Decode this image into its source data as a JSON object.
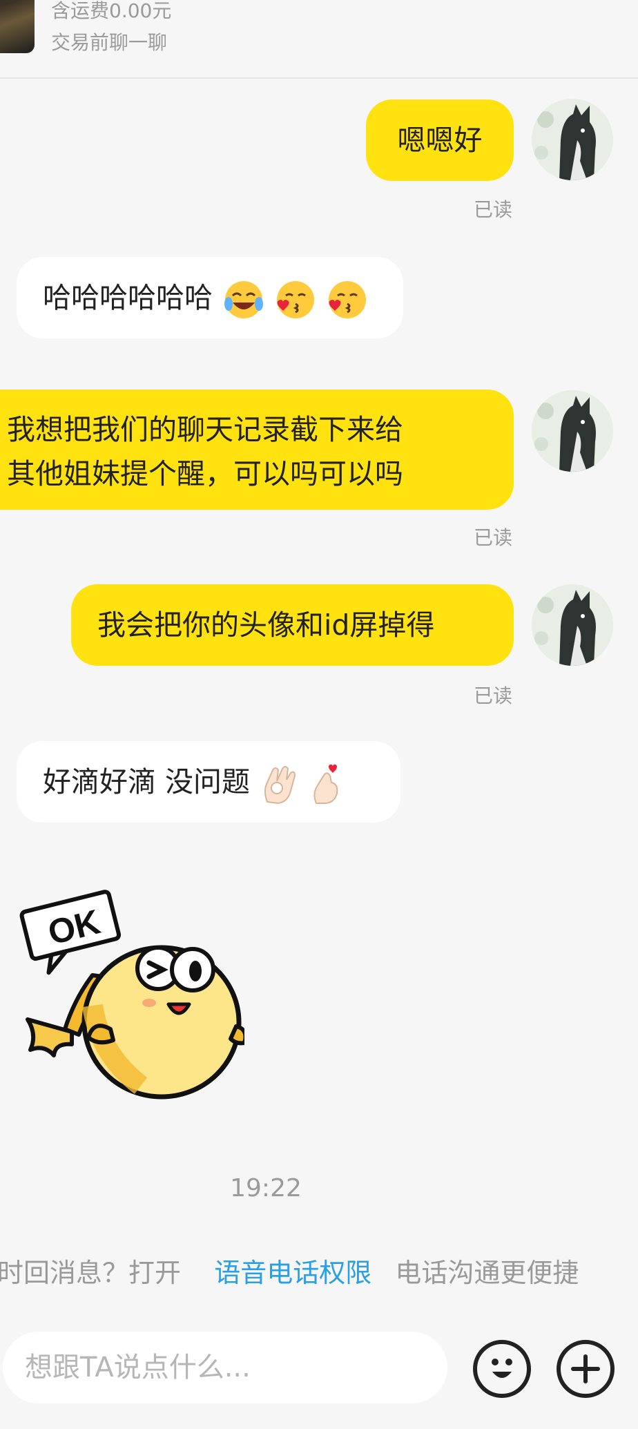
{
  "header": {
    "shipping": "含运费0.00元",
    "chat_prompt": "交易前聊一聊"
  },
  "messages": [
    {
      "side": "me",
      "text": "嗯嗯好",
      "status": "已读"
    },
    {
      "side": "them",
      "text": "哈哈哈哈哈哈"
    },
    {
      "side": "me",
      "lines": [
        "我想把我们的聊天记录截下来给",
        "其他姐妹提个醒，可以吗可以吗"
      ],
      "status": "已读"
    },
    {
      "side": "me",
      "text": "我会把你的头像和id屏掉得",
      "status": "已读"
    },
    {
      "side": "them",
      "text": "好滴好滴 没问题"
    },
    {
      "side": "them",
      "sticker_text": "OK"
    }
  ],
  "timestamp": "19:22",
  "notice": {
    "prefix": "时回消息？打开",
    "link": "语音电话权限",
    "suffix": "电话沟通更便捷"
  },
  "composer": {
    "placeholder": "想跟TA说点什么..."
  },
  "icons": {
    "emoji_button": "smiley-icon",
    "plus_button": "plus-icon"
  },
  "colors": {
    "my_bubble": "#ffe20f",
    "their_bubble": "#ffffff",
    "link": "#2a9fe4",
    "background": "#f6f6f6"
  }
}
